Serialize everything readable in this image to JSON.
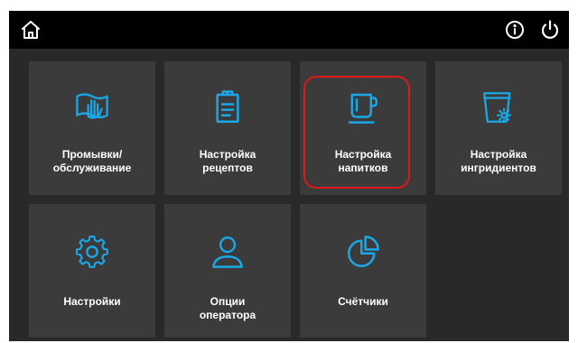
{
  "topbar": {
    "home_icon": "home-icon",
    "info_icon": "info-icon",
    "power_icon": "power-icon"
  },
  "colors": {
    "accent": "#1aa8e8",
    "tile_bg": "#3b3b3b",
    "screen_bg": "#292929",
    "topbar_bg": "#000000",
    "highlight": "#e01818"
  },
  "tiles": [
    {
      "label": "Промывки/\nобслуживание",
      "icon": "hand-wash-icon"
    },
    {
      "label": "Настройка\nрецептов",
      "icon": "recipe-clipboard-icon"
    },
    {
      "label": "Настройка\nнапитков",
      "icon": "cup-icon",
      "highlighted": true
    },
    {
      "label": "Настройка\nингридиентов",
      "icon": "ingredient-cup-gear-icon"
    },
    {
      "label": "Настройки",
      "icon": "gear-icon"
    },
    {
      "label": "Опции\nоператора",
      "icon": "operator-user-icon"
    },
    {
      "label": "Счётчики",
      "icon": "counter-pie-icon"
    }
  ]
}
